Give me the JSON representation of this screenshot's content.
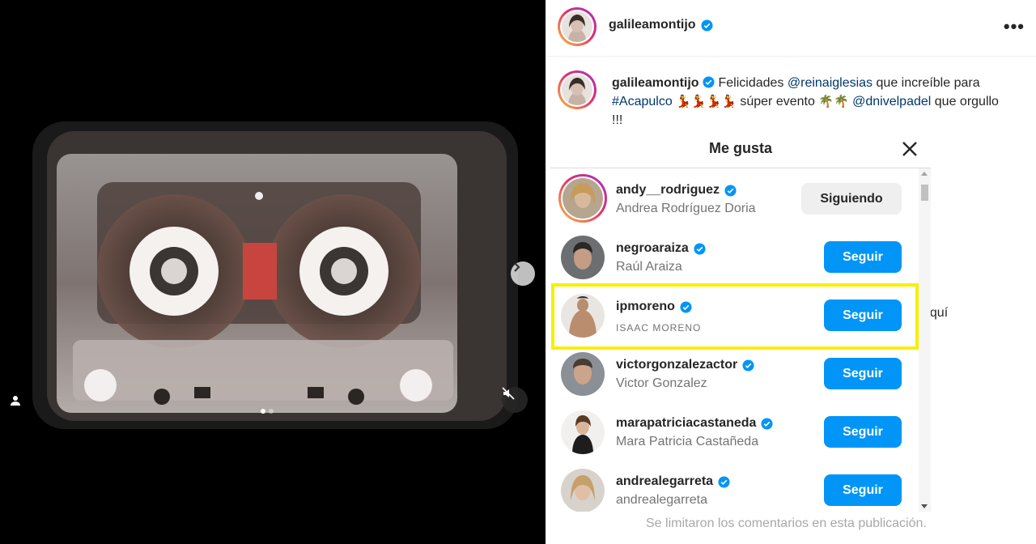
{
  "post": {
    "author": "galileamontijo",
    "more_label": "•••"
  },
  "caption": {
    "author": "galileamontijo",
    "text_1": "Felicidades",
    "mention_1": "@reinaiglesias",
    "text_2": "que increíble para",
    "hashtag": "#Acapulco",
    "emoji_1": "💃💃💃💃",
    "text_3": "súper evento",
    "emoji_2": "🌴🌴",
    "mention_2": "@dnivelpadel",
    "text_4": "que orgullo !!!"
  },
  "modal": {
    "title": "Me gusta",
    "close_label": "×"
  },
  "likes": [
    {
      "username": "andy__rodriguez",
      "full_name": "Andrea Rodríguez Doria",
      "button": "Siguiendo",
      "state": "following"
    },
    {
      "username": "negroaraiza",
      "full_name": "Raúl Araiza",
      "button": "Seguir",
      "state": "follow"
    },
    {
      "username": "ipmoreno",
      "full_name": "ISAAC MORENO",
      "button": "Seguir",
      "state": "follow"
    },
    {
      "username": "victorgonzalezactor",
      "full_name": "Victor Gonzalez",
      "button": "Seguir",
      "state": "follow"
    },
    {
      "username": "marapatriciacastaneda",
      "full_name": "Mara Patricia Castañeda",
      "button": "Seguir",
      "state": "follow"
    },
    {
      "username": "andrealegarreta",
      "full_name": "andrealegarreta",
      "button": "Seguir",
      "state": "follow"
    }
  ],
  "background_text": {
    "aqui": "aquí",
    "comments_limited": "Se limitaron los comentarios en esta publicación."
  },
  "colors": {
    "follow_button": "#0095f6",
    "following_button": "#efefef",
    "highlight": "#f8ef00",
    "verified": "#0095f6"
  },
  "icons": [
    "verified-badge-icon",
    "close-icon",
    "chevron-right-icon",
    "muted-speaker-icon",
    "user-tag-icon",
    "more-options-icon"
  ]
}
